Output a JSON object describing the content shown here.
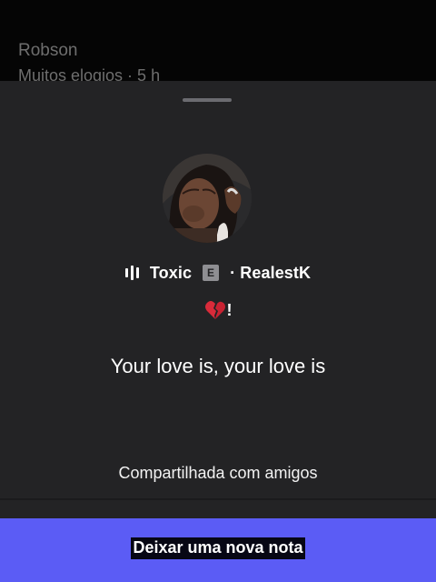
{
  "background": {
    "name": "Robson",
    "subtitle": "Muitos elogios · 5 h"
  },
  "note": {
    "song_title": "Toxic",
    "explicit_badge": "E",
    "artist": "· RealestK",
    "emoji_icon": "broken-heart-icon",
    "emoji_suffix": "!",
    "text": "Your love is, your love is",
    "audience": "Compartilhada com amigos"
  },
  "cta": {
    "label": "Deixar uma nova nota",
    "color": "#5b5cf5"
  },
  "colors": {
    "sheet": "#232325",
    "header": "#050505"
  }
}
